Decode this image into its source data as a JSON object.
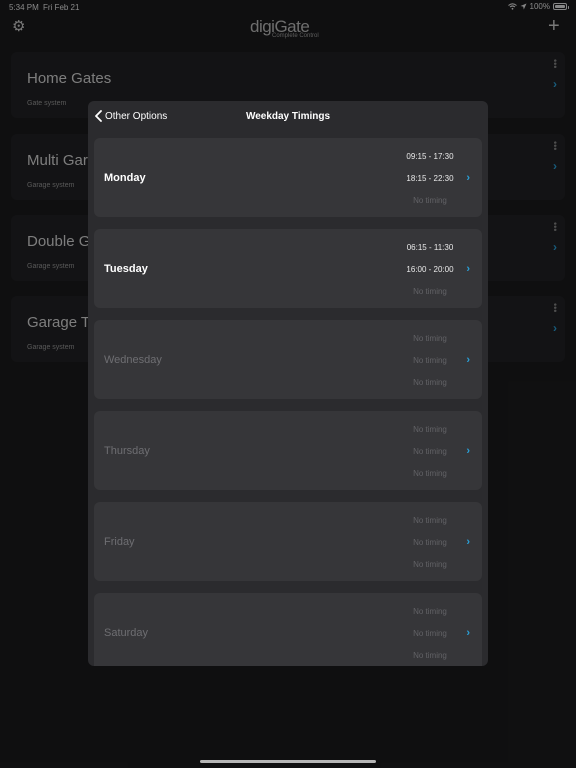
{
  "status_bar": {
    "time": "5:34 PM",
    "date": "Fri Feb 21",
    "battery": "100%"
  },
  "nav": {
    "logo_main": "digiGate",
    "logo_sub": "Complete Control",
    "settings_icon": "gear-icon",
    "add_icon": "plus-icon"
  },
  "devices": [
    {
      "name": "Home Gates",
      "type": "Gate system"
    },
    {
      "name": "Multi Gar",
      "type": "Garage system"
    },
    {
      "name": "Double G",
      "type": "Garage system"
    },
    {
      "name": "Garage Te",
      "type": "Garage system"
    }
  ],
  "modal": {
    "back_label": "Other Options",
    "title": "Weekday Timings",
    "days": [
      {
        "name": "Monday",
        "slots": [
          "09:15 - 17:30",
          "18:15 - 22:30",
          "No timing"
        ]
      },
      {
        "name": "Tuesday",
        "slots": [
          "06:15 - 11:30",
          "16:00 - 20:00",
          "No timing"
        ]
      },
      {
        "name": "Wednesday",
        "slots": [
          "No timing",
          "No timing",
          "No timing"
        ]
      },
      {
        "name": "Thursday",
        "slots": [
          "No timing",
          "No timing",
          "No timing"
        ]
      },
      {
        "name": "Friday",
        "slots": [
          "No timing",
          "No timing",
          "No timing"
        ]
      },
      {
        "name": "Saturday",
        "slots": [
          "No timing",
          "No timing",
          "No timing"
        ]
      }
    ]
  },
  "colors": {
    "accent": "#2a9fd6",
    "background": "#1b1b1d",
    "modal": "#2b2b2e",
    "card": "#363639"
  }
}
